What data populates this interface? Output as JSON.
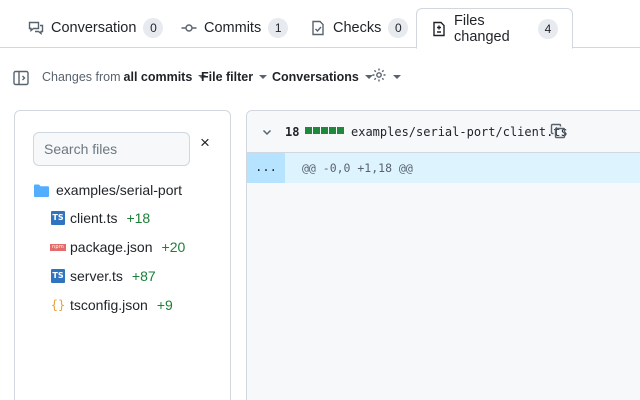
{
  "tabs": [
    {
      "label": "Conversation",
      "count": "0",
      "icon": "comment-discussion-icon"
    },
    {
      "label": "Commits",
      "count": "1",
      "icon": "git-commit-icon"
    },
    {
      "label": "Checks",
      "count": "0",
      "icon": "checklist-icon"
    },
    {
      "label": "Files changed",
      "count": "4",
      "icon": "file-diff-icon",
      "selected": true
    }
  ],
  "toolbar": {
    "changes_prefix": "Changes from",
    "changes_value": "all commits",
    "file_filter": "File filter",
    "conversations": "Conversations",
    "settings_icon": "gear-icon",
    "sidebar_icon": "sidebar-expand-icon"
  },
  "file_tree": {
    "search_placeholder": "Search files",
    "clear_symbol": "×",
    "folder": "examples/serial-port",
    "files": [
      {
        "name": "client.ts",
        "additions": "+18",
        "icon": "typescript-icon"
      },
      {
        "name": "package.json",
        "additions": "+20",
        "icon": "npm-icon"
      },
      {
        "name": "server.ts",
        "additions": "+87",
        "icon": "typescript-icon"
      },
      {
        "name": "tsconfig.json",
        "additions": "+9",
        "icon": "json-icon"
      }
    ]
  },
  "diff": {
    "line_count": "18",
    "path": "examples/serial-port/client.ts",
    "expand_label": "...",
    "hunk_header": "@@ -0,0 +1,18 @@"
  },
  "colors": {
    "addition": "#1a7f37",
    "diffstat_block": "#1f883d",
    "hunk_bg": "#ddf4ff",
    "ts_blue": "#2f74c0",
    "npm_red": "#e56b6b",
    "json_orange": "#e8a33d",
    "folder_blue": "#54aeff"
  }
}
